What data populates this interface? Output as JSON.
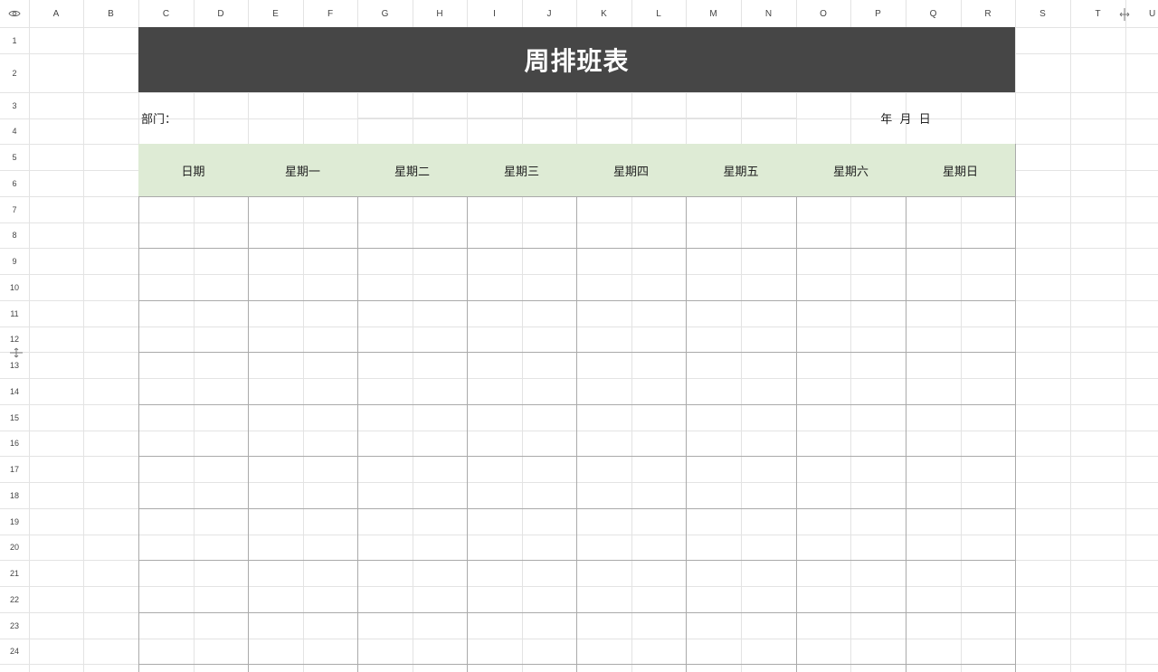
{
  "colors": {
    "title_bg": "#464646",
    "title_text": "#ffffff",
    "header_row_bg": "#deebd5",
    "gridline": "#e3e3e3",
    "table_border": "#aaaaaa"
  },
  "column_headers": [
    "A",
    "B",
    "C",
    "D",
    "E",
    "F",
    "G",
    "H",
    "I",
    "J",
    "K",
    "L",
    "M",
    "N",
    "O",
    "P",
    "Q",
    "R",
    "S",
    "T",
    "U"
  ],
  "row_headers": [
    "1",
    "2",
    "3",
    "4",
    "5",
    "6",
    "7",
    "8",
    "9",
    "10",
    "11",
    "12",
    "13",
    "14",
    "15",
    "16",
    "17",
    "18",
    "19",
    "20",
    "21",
    "22",
    "23",
    "24"
  ],
  "toolbar": {
    "visibility_icon": "eye-icon",
    "column_resize_icon": "resize-handle-icon",
    "row_resize_icon": "resize-handle-icon"
  },
  "sheet": {
    "title": "周排班表",
    "department_label": "部门：",
    "date_label": "年  月  日",
    "day_headers": [
      "日期",
      "星期一",
      "星期二",
      "星期三",
      "星期四",
      "星期五",
      "星期六",
      "星期日"
    ]
  }
}
